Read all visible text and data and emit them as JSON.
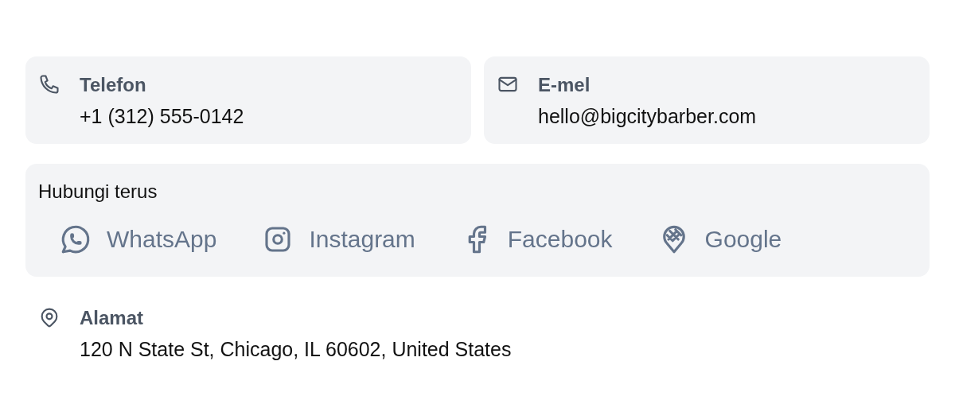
{
  "contacts": [
    {
      "kind": "phone",
      "label": "Telefon",
      "value": "+1 (312) 555-0142"
    },
    {
      "kind": "email",
      "label": "E-mel",
      "value": "hello@bigcitybarber.com"
    }
  ],
  "direct": {
    "title": "Hubungi terus",
    "links": [
      {
        "kind": "whatsapp",
        "label": "WhatsApp"
      },
      {
        "kind": "instagram",
        "label": "Instagram"
      },
      {
        "kind": "facebook",
        "label": "Facebook"
      },
      {
        "kind": "google",
        "label": "Google"
      }
    ]
  },
  "address": {
    "kind": "pin",
    "label": "Alamat",
    "value": "120 N State St, Chicago, IL 60602, United States"
  }
}
